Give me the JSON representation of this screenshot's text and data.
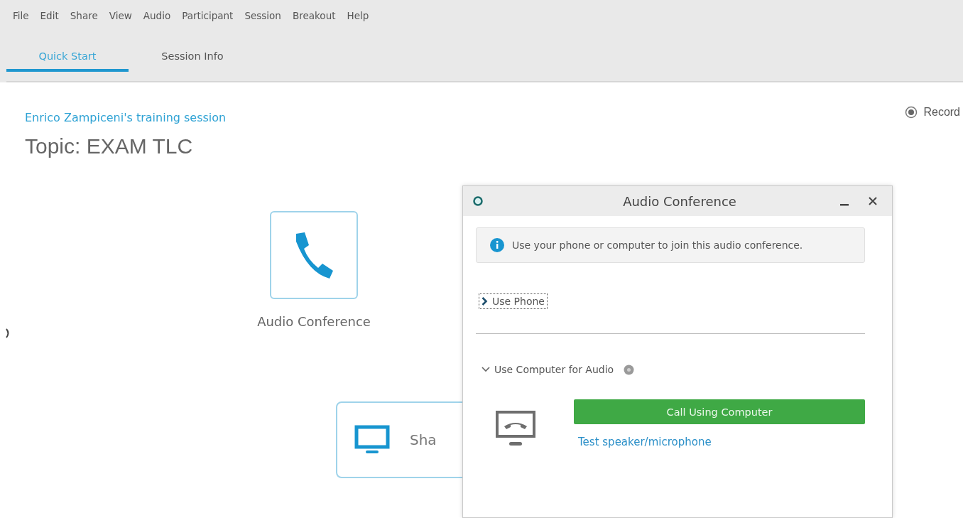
{
  "menu": [
    {
      "label": "File"
    },
    {
      "label": "Edit"
    },
    {
      "label": "Share"
    },
    {
      "label": "View"
    },
    {
      "label": "Audio"
    },
    {
      "label": "Participant"
    },
    {
      "label": "Session"
    },
    {
      "label": "Breakout"
    },
    {
      "label": "Help"
    }
  ],
  "tabs": [
    {
      "label": "Quick Start",
      "selected": true
    },
    {
      "label": "Session Info",
      "selected": false
    }
  ],
  "session_link": "Enrico Zampiceni's training session",
  "topic": "Topic: EXAM TLC",
  "record": {
    "label": "Record"
  },
  "tiles": [
    {
      "kind": "audio",
      "label": "Audio Conference"
    },
    {
      "kind": "share",
      "label": "Sha"
    }
  ],
  "dialog": {
    "title": "Audio Conference",
    "info": "Use your phone or computer to join this audio conference.",
    "use_phone": {
      "label": "Use Phone",
      "expanded": false
    },
    "computer_section": {
      "label": "Use Computer for Audio",
      "expanded": true
    },
    "call_button": "Call Using Computer",
    "test_link": "Test speaker/microphone"
  }
}
